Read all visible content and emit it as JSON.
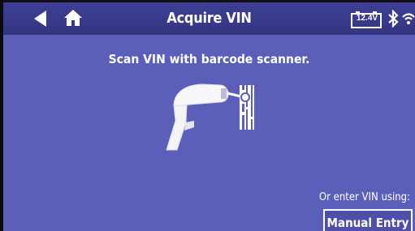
{
  "header": {
    "title": "Acquire VIN",
    "back_icon": "back-arrow-icon",
    "home_icon": "home-icon",
    "battery_voltage": "12.4V",
    "bluetooth_icon": "bluetooth-icon",
    "wifi_icon": "wifi-icon"
  },
  "main": {
    "instruction": "Scan VIN with barcode scanner.",
    "illustration_icon": "barcode-scanner-icon",
    "alternate_label": "Or enter VIN using:",
    "manual_entry_label": "Manual Entry"
  },
  "colors": {
    "background": "#5b5fba",
    "topbar": "#3a3b8c",
    "text": "#ffffff"
  }
}
